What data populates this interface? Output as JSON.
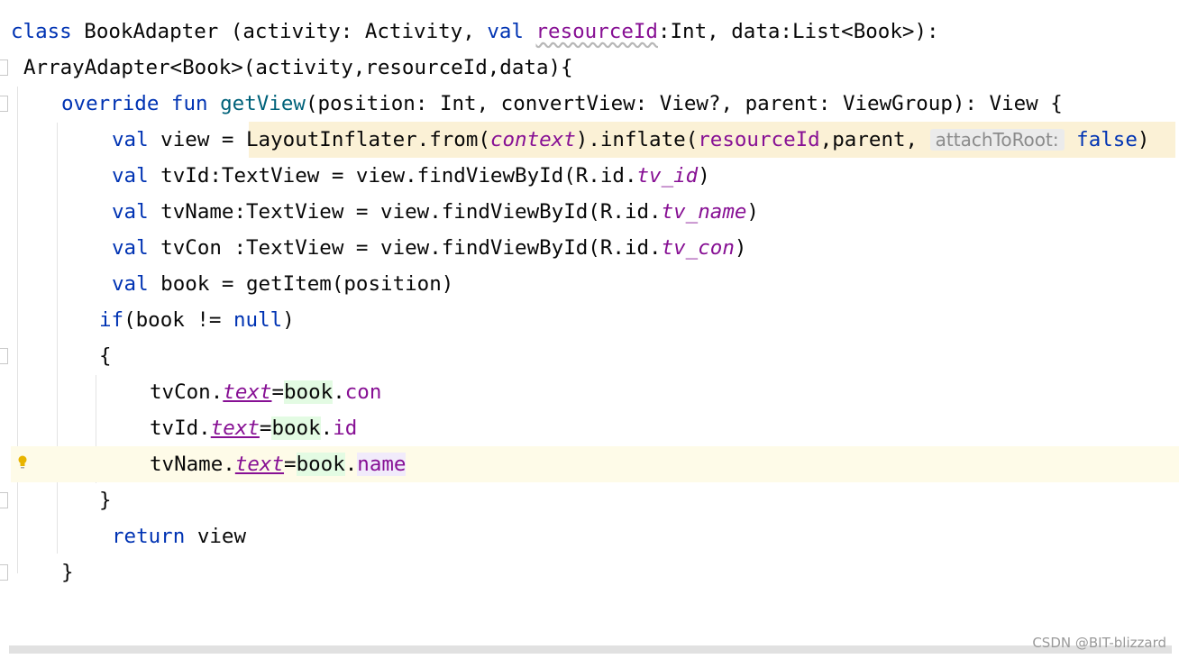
{
  "code": {
    "l1": {
      "kw_class": "class",
      "t1": " BookAdapter (activity: Activity, ",
      "kw_val": "val",
      "t2": " ",
      "p1": "resourceId",
      "t3": ":Int, data:List<Book>):"
    },
    "l2": {
      "t1": "ArrayAdapter<Book>(activity,resourceId,data){"
    },
    "l3": {
      "kw1": "override",
      "t1": " ",
      "kw2": "fun",
      "t2": " ",
      "fn": "getView",
      "t3": "(position: Int, convertView: View?, parent: ViewGroup): View {"
    },
    "l4": {
      "kw": "val",
      "t1": " view = ",
      "t2": "LayoutInflater.from(",
      "p1": "context",
      "t3": ").inflate(",
      "p2": "resourceId",
      "t4": ",parent, ",
      "hint": "attachToRoot:",
      "t5": " ",
      "kw2": "false",
      "t6": ")"
    },
    "l5": {
      "kw": "val",
      "t1": " tvId:TextView = view.findViewById(R.id.",
      "p1": "tv_id",
      "t2": ")"
    },
    "l6": {
      "kw": "val",
      "t1": " tvName:TextView = view.findViewById(R.id.",
      "p1": "tv_name",
      "t2": ")"
    },
    "l7": {
      "kw": "val",
      "t1": " tvCon :TextView = view.findViewById(R.id.",
      "p1": "tv_con",
      "t2": ")"
    },
    "l8": {
      "kw": "val",
      "t1": " book = getItem(position)"
    },
    "l9": {
      "kw": "if",
      "t1": "(book != ",
      "kw2": "null",
      "t2": ")"
    },
    "l10": {
      "t1": "{"
    },
    "l11": {
      "t1": "tvCon.",
      "p1": "text",
      "t2": "=",
      "g": "book",
      "t3": ".",
      "p2": "con"
    },
    "l12": {
      "t1": "tvId.",
      "p1": "text",
      "t2": "=",
      "g": "book",
      "t3": ".",
      "p2": "id"
    },
    "l13": {
      "t1": "tvName.",
      "p1": "text",
      "t2": "=",
      "g": "book",
      "t3": ".",
      "p2": "name"
    },
    "l14": {
      "t1": "}"
    },
    "l15": {
      "kw": "return",
      "t1": " view"
    },
    "l16": {
      "t1": "}"
    }
  },
  "icons": {
    "intention": "lightbulb-icon"
  },
  "colors": {
    "keyword": "#0033b3",
    "function": "#00627a",
    "property": "#871094",
    "caret_line": "#fefbe8",
    "warning": "#fbf1d6"
  },
  "watermark": "CSDN @BIT-blizzard"
}
